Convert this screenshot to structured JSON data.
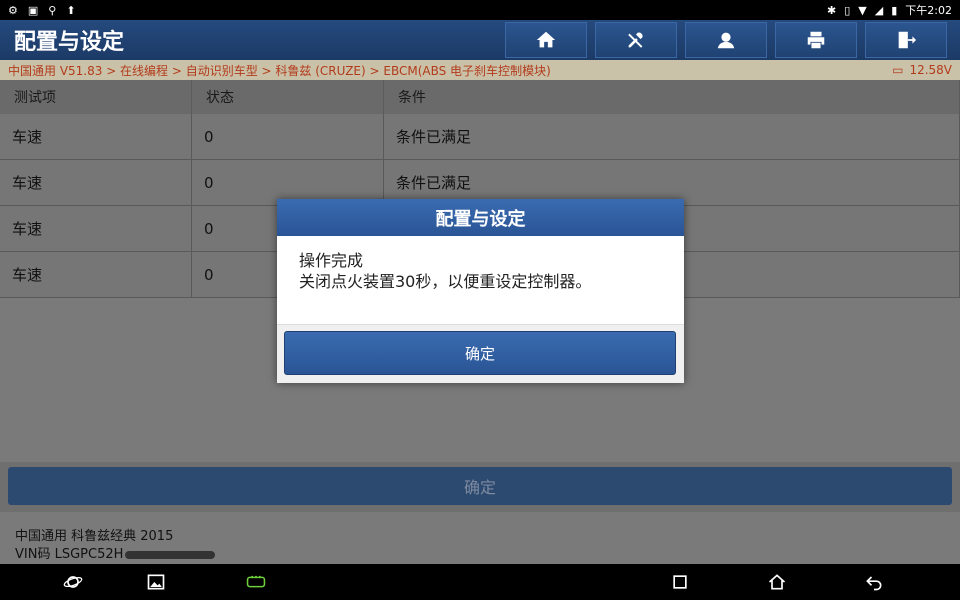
{
  "status_bar": {
    "left_icons": [
      "settings-icon",
      "image-icon",
      "usb-icon",
      "upload-icon"
    ],
    "time": "下午2:02"
  },
  "header": {
    "title": "配置与设定",
    "buttons": [
      "home-icon",
      "tools-icon",
      "support-icon",
      "print-icon",
      "exit-icon"
    ]
  },
  "breadcrumb": {
    "path": "中国通用 V51.83 > 在线编程 > 自动识别车型 > 科鲁兹 (CRUZE) > EBCM(ABS 电子刹车控制模块)",
    "voltage": "12.58V"
  },
  "table": {
    "columns": [
      "测试项",
      "状态",
      "条件"
    ],
    "rows": [
      [
        "车速",
        "0",
        "条件已满足"
      ],
      [
        "车速",
        "0",
        "条件已满足"
      ],
      [
        "车速",
        "0",
        ""
      ],
      [
        "车速",
        "0",
        ""
      ]
    ]
  },
  "bottom": {
    "confirm_label": "确定",
    "vehicle": "中国通用 科鲁兹经典 2015",
    "vin_prefix": "VIN码 LSGPC52H"
  },
  "dialog": {
    "title": "配置与设定",
    "line1": "操作完成",
    "line2": "关闭点火装置30秒，以便重设定控制器。",
    "button": "确定"
  },
  "colors": {
    "title_bar": "#1f3f6e",
    "breadcrumb_text": "#b33b1c",
    "dialog_accent": "#2f5da0"
  }
}
